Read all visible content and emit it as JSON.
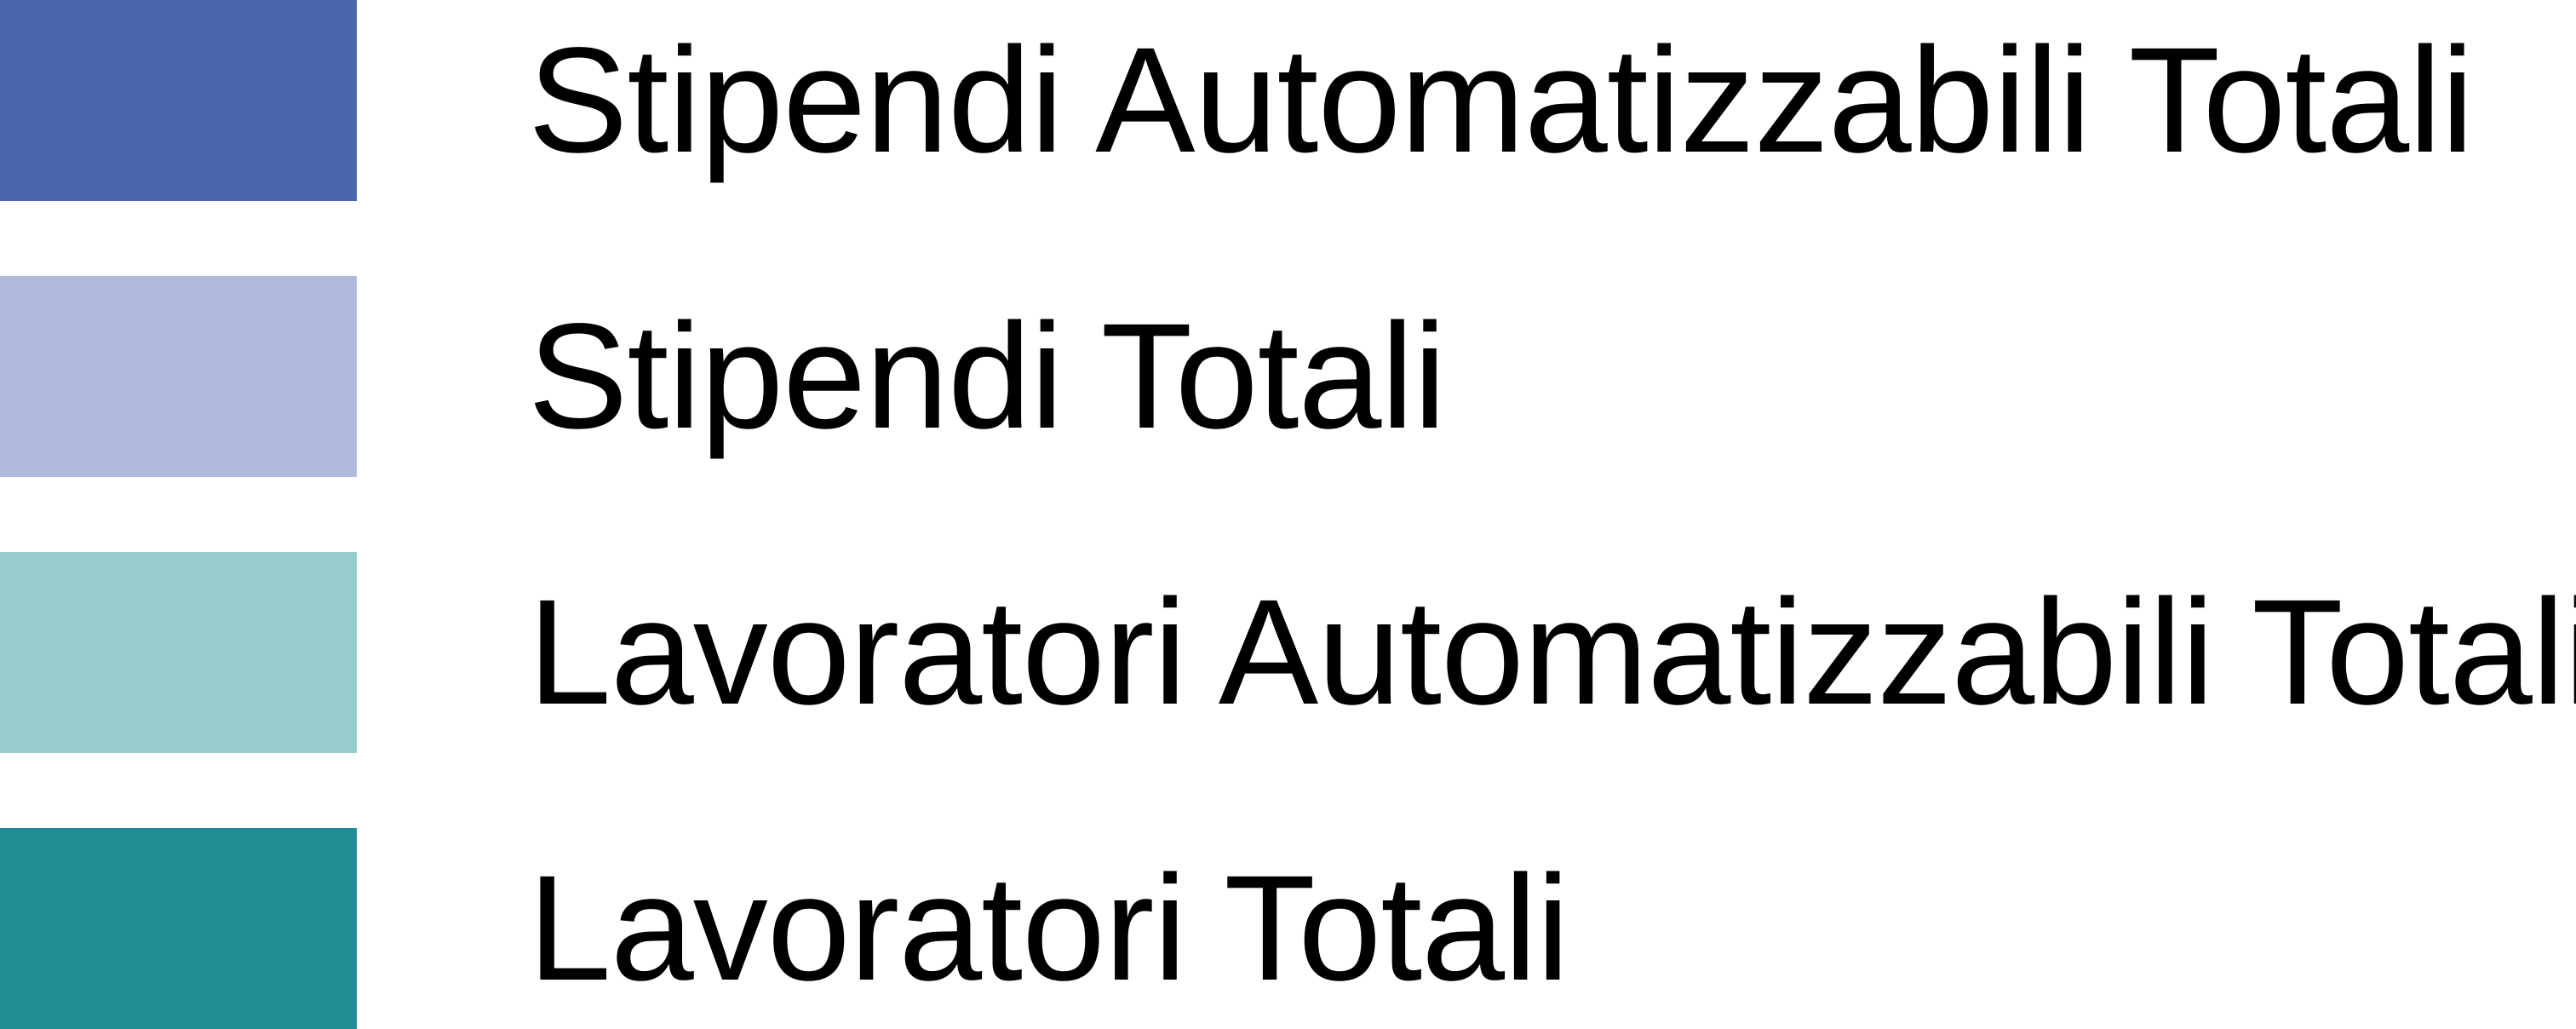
{
  "chart_data": {
    "type": "bar",
    "legend": {
      "entries": [
        {
          "label": "Stipendi Automatizzabili Totali",
          "color": "#4a66ac"
        },
        {
          "label": "Stipendi Totali",
          "color": "#b0bbdb"
        },
        {
          "label": "Lavoratori Automatizzabili Totali",
          "color": "#96cccb"
        },
        {
          "label": "Lavoratori Totali",
          "color": "#228c94"
        }
      ]
    }
  }
}
